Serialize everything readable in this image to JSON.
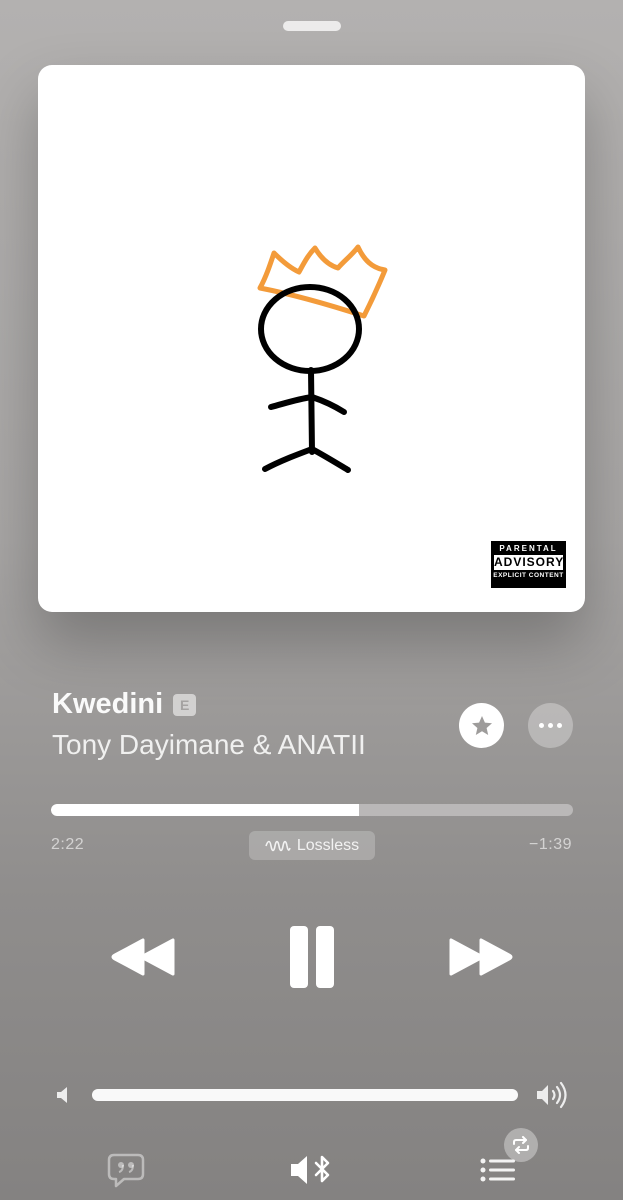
{
  "artwork": {
    "advisory": {
      "line1": "PARENTAL",
      "line2": "ADVISORY",
      "line3": "EXPLICIT CONTENT"
    },
    "crown_color": "#f39b3a"
  },
  "track": {
    "title": "Kwedini",
    "explicit_badge": "E",
    "artist": "Tony Dayimane & ANATII"
  },
  "progress": {
    "elapsed": "2:22",
    "remaining": "−1:39",
    "fraction": 0.59,
    "quality_badge": "Lossless"
  },
  "volume": {
    "level": 1.0
  },
  "icons": {
    "favorite": "star-icon",
    "more": "ellipsis-icon",
    "rewind": "rewind-icon",
    "pause": "pause-icon",
    "forward": "fast-forward-icon",
    "volume_low": "speaker-icon",
    "volume_high": "speaker-wave-icon",
    "lyrics": "lyrics-quote-icon",
    "audio_output": "speaker-bluetooth-icon",
    "queue": "queue-list-icon",
    "repeat": "repeat-icon"
  },
  "colors": {
    "background_top": "#b3b1b0",
    "background_bottom": "#848281",
    "foreground": "#ffffff"
  }
}
